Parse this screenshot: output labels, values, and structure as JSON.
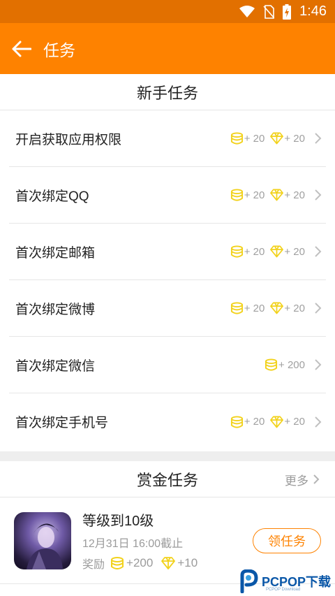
{
  "status_bar": {
    "time": "1:46",
    "icons": [
      "wifi-icon",
      "no-sim-icon",
      "battery-charging-icon"
    ],
    "color": "#e27000"
  },
  "app_bar": {
    "title": "任务",
    "back_icon": "arrow-left-icon",
    "color": "#fe8200"
  },
  "newbie_section": {
    "header": "新手任务",
    "tasks": [
      {
        "name": "开启获取应用权限",
        "coin": "+ 20",
        "gem": "+ 20"
      },
      {
        "name": "首次绑定QQ",
        "coin": "+ 20",
        "gem": "+ 20"
      },
      {
        "name": "首次绑定邮箱",
        "coin": "+ 20",
        "gem": "+ 20"
      },
      {
        "name": "首次绑定微博",
        "coin": "+ 20",
        "gem": "+ 20"
      },
      {
        "name": "首次绑定微信",
        "coin": "+ 200",
        "gem": null
      },
      {
        "name": "首次绑定手机号",
        "coin": "+ 20",
        "gem": "+ 20"
      }
    ]
  },
  "bounty_section": {
    "header": "赏金任务",
    "more": "更多",
    "item": {
      "title": "等级到10级",
      "deadline": "12月31日 16:00截止",
      "reward_label": "奖励",
      "coin": "+200",
      "gem": "+10",
      "button": "领任务"
    }
  },
  "watermark": {
    "text": "PCPOP下载",
    "sub": "PCPOP Download"
  },
  "colors": {
    "accent": "#fe8200",
    "reward_icon": "#f2d21c"
  }
}
